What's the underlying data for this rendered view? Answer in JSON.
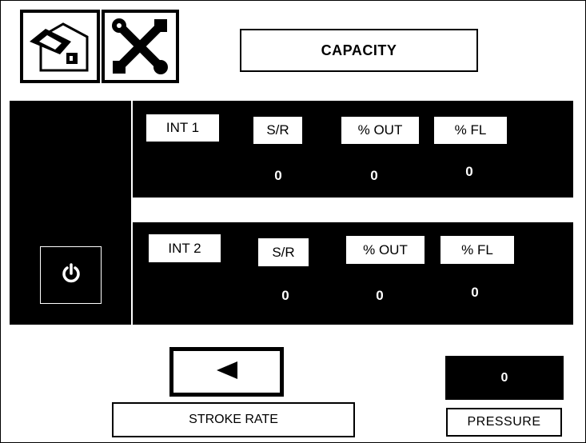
{
  "header": {
    "home_icon": "home-icon",
    "tools_icon": "tools-icon",
    "title": "CAPACITY"
  },
  "channels": [
    {
      "name": "INT 1",
      "sr_label": "S/R",
      "out_label": "% OUT",
      "fl_label": "% FL",
      "sr_value": "0",
      "out_value": "0",
      "fl_value": "0"
    },
    {
      "name": "INT 2",
      "sr_label": "S/R",
      "out_label": "% OUT",
      "fl_label": "% FL",
      "sr_value": "0",
      "out_value": "0",
      "fl_value": "0"
    }
  ],
  "power_icon": "power-icon",
  "stroke_rate": {
    "arrow_icon": "arrow-left-icon",
    "label": "STROKE RATE"
  },
  "pressure": {
    "value": "0",
    "label": "PRESSURE"
  },
  "colors": {
    "background": "#ffffff",
    "panel": "#000000",
    "text_on_panel": "#ffffff"
  }
}
